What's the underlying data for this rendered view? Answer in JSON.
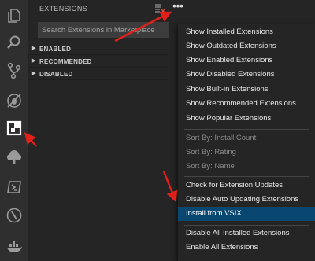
{
  "activity_bar": {
    "icons": [
      "files-icon",
      "search-icon",
      "source-control-icon",
      "debug-icon",
      "extensions-icon",
      "tree-icon",
      "terminal-icon",
      "node-icon",
      "docker-icon"
    ]
  },
  "sidebar": {
    "title": "EXTENSIONS",
    "search": {
      "placeholder": "Search Extensions in Marketplace",
      "value": ""
    },
    "sections": [
      "ENABLED",
      "RECOMMENDED",
      "DISABLED"
    ]
  },
  "menu": {
    "group1": [
      "Show Installed Extensions",
      "Show Outdated Extensions",
      "Show Enabled Extensions",
      "Show Disabled Extensions",
      "Show Built-in Extensions",
      "Show Recommended Extensions",
      "Show Popular Extensions"
    ],
    "group2": [
      "Sort By: Install Count",
      "Sort By: Rating",
      "Sort By: Name"
    ],
    "group3": [
      "Check for Extension Updates",
      "Disable Auto Updating Extensions",
      "Install from VSIX..."
    ],
    "group4": [
      "Disable All Installed Extensions",
      "Enable All Extensions"
    ]
  },
  "colors": {
    "activity_bar": "#2f2f2f",
    "sidebar": "#252526",
    "menu_highlight": "#094771",
    "annotation_arrow": "#e0201b"
  }
}
